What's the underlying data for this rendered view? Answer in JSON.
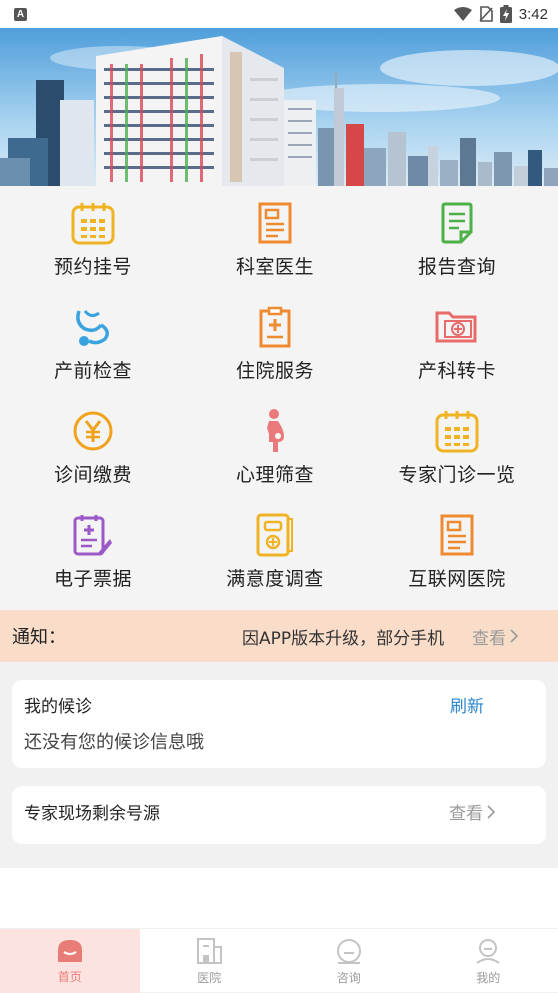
{
  "status_bar": {
    "time": "3:42",
    "notification_glyph": "A"
  },
  "grid": {
    "items": [
      {
        "label": "预约挂号",
        "icon": "calendar-icon",
        "color": "#f0b323"
      },
      {
        "label": "科室医生",
        "icon": "doctor-card-icon",
        "color": "#ee8a2f"
      },
      {
        "label": "报告查询",
        "icon": "report-icon",
        "color": "#4cb147"
      },
      {
        "label": "产前检查",
        "icon": "stethoscope-icon",
        "color": "#39a3df"
      },
      {
        "label": "住院服务",
        "icon": "clipboard-plus-icon",
        "color": "#ee8a2f"
      },
      {
        "label": "产科转卡",
        "icon": "medical-folder-icon",
        "color": "#e96a6a"
      },
      {
        "label": "诊间缴费",
        "icon": "yen-coin-icon",
        "color": "#f0a21c"
      },
      {
        "label": "心理筛查",
        "icon": "pregnant-woman-icon",
        "color": "#e9797a"
      },
      {
        "label": "专家门诊一览",
        "icon": "schedule-icon",
        "color": "#f0b323"
      },
      {
        "label": "电子票据",
        "icon": "e-receipt-icon",
        "color": "#9b59c8"
      },
      {
        "label": "满意度调查",
        "icon": "survey-book-icon",
        "color": "#f0b323"
      },
      {
        "label": "互联网医院",
        "icon": "internet-hospital-icon",
        "color": "#ee8a2f"
      }
    ]
  },
  "notice": {
    "title": "通知：",
    "text": "因APP版本升级，部分手机",
    "more": "查看"
  },
  "queue_card": {
    "title": "我的候诊",
    "refresh": "刷新",
    "empty": "还没有您的候诊信息哦"
  },
  "expert_card": {
    "title": "专家现场剩余号源",
    "more": "查看"
  },
  "tabbar": {
    "tabs": [
      {
        "label": "首页",
        "icon": "home-icon",
        "active": true
      },
      {
        "label": "医院",
        "icon": "hospital-icon",
        "active": false
      },
      {
        "label": "咨询",
        "icon": "consult-icon",
        "active": false
      },
      {
        "label": "我的",
        "icon": "profile-icon",
        "active": false
      }
    ]
  },
  "colors": {
    "accent_blue": "#2a86d1",
    "notice_bg": "#f9ddc9",
    "tab_active": "#e87d78"
  }
}
